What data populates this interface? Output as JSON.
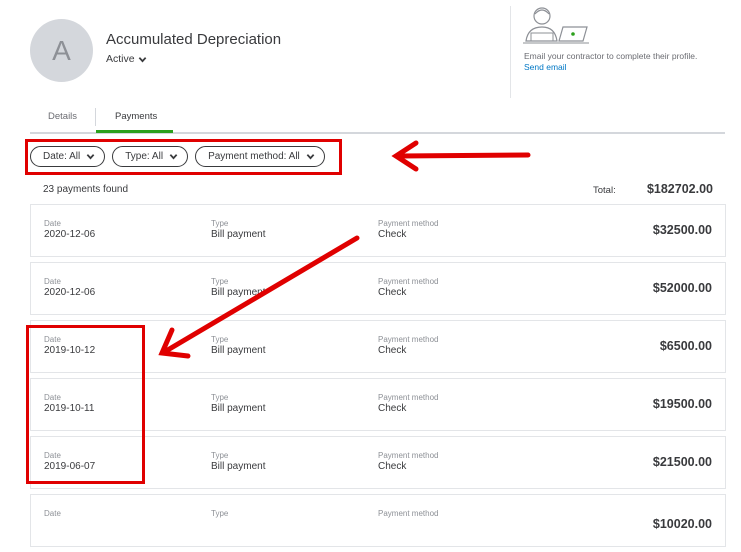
{
  "header": {
    "avatar_initial": "A",
    "name": "Accumulated Depreciation",
    "status": "Active"
  },
  "promo": {
    "text": "Email your contractor to complete their profile.",
    "link": "Send email"
  },
  "tabs": [
    {
      "label": "Details",
      "active": false
    },
    {
      "label": "Payments",
      "active": true
    }
  ],
  "filters": [
    {
      "label": "Date: All"
    },
    {
      "label": "Type: All"
    },
    {
      "label": "Payment method: All"
    }
  ],
  "summary": {
    "count_text": "23 payments found",
    "total_label": "Total:",
    "total_value": "$182702.00"
  },
  "columns": {
    "date": "Date",
    "type": "Type",
    "method": "Payment method"
  },
  "payments": [
    {
      "date": "2020-12-06",
      "type": "Bill payment",
      "method": "Check",
      "amount": "$32500.00"
    },
    {
      "date": "2020-12-06",
      "type": "Bill payment",
      "method": "Check",
      "amount": "$52000.00"
    },
    {
      "date": "2019-10-12",
      "type": "Bill payment",
      "method": "Check",
      "amount": "$6500.00"
    },
    {
      "date": "2019-10-11",
      "type": "Bill payment",
      "method": "Check",
      "amount": "$19500.00"
    },
    {
      "date": "2019-06-07",
      "type": "Bill payment",
      "method": "Check",
      "amount": "$21500.00"
    },
    {
      "date": "",
      "type": "",
      "method": "",
      "amount": "$10020.00"
    }
  ],
  "colors": {
    "accent_green": "#2ca01c",
    "link_blue": "#0077c5",
    "annotation_red": "#e00000"
  }
}
